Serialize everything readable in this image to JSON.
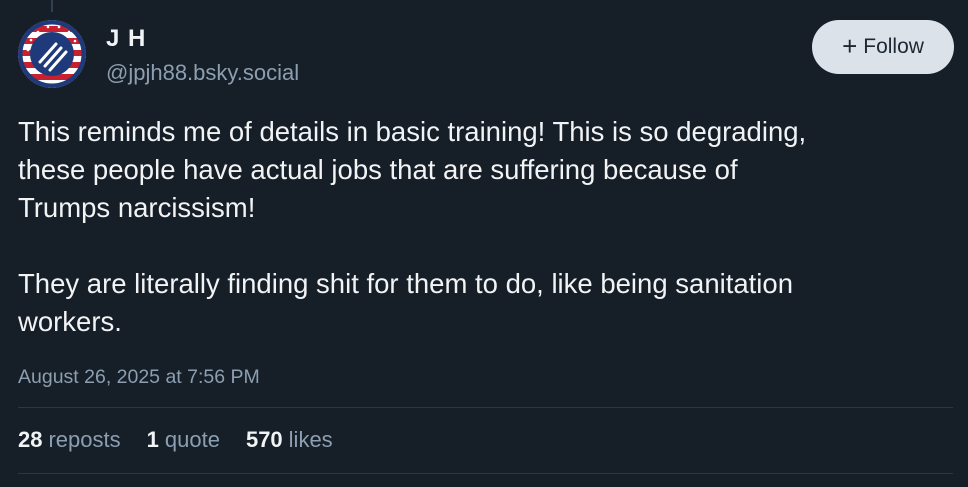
{
  "author": {
    "display_name": "J H",
    "handle": "@jpjh88.bsky.social"
  },
  "follow_button": {
    "icon": "plus-icon",
    "label": "Follow"
  },
  "post": {
    "text": "This reminds me of details in basic training! This is so degrading,\nthese people have actual jobs that are suffering because of\nTrumps narcissism!\n\nThey are literally finding shit for them to do, like being sanitation\nworkers.",
    "timestamp": "August 26, 2025 at 7:56 PM"
  },
  "stats": {
    "reposts_count": "28",
    "reposts_label": "reposts",
    "quotes_count": "1",
    "quotes_label": "quote",
    "likes_count": "570",
    "likes_label": "likes"
  },
  "colors": {
    "background": "#161e27",
    "text_primary": "#f1f3f5",
    "text_secondary": "#8c9fb2",
    "button_bg": "#dce2ea"
  }
}
